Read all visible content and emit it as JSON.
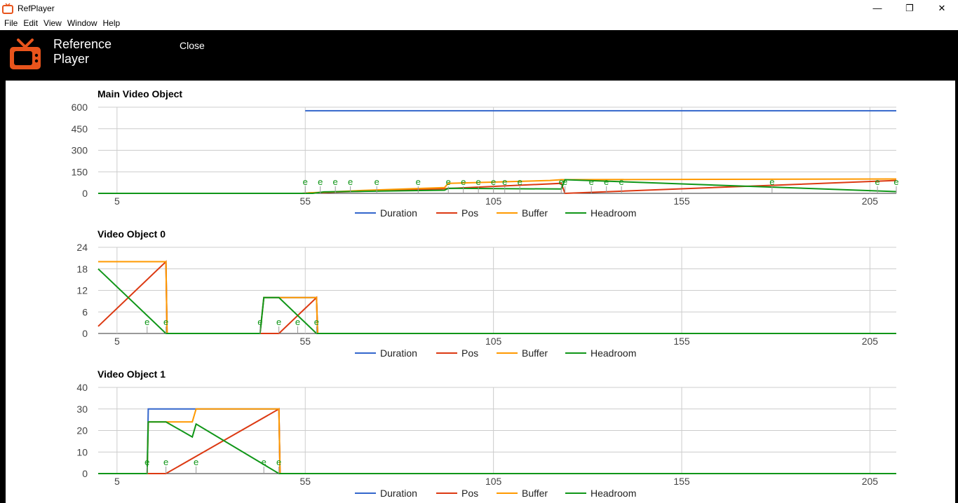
{
  "window": {
    "title": "RefPlayer",
    "controls": [
      "minimize",
      "restore",
      "close"
    ]
  },
  "menu": [
    "File",
    "Edit",
    "View",
    "Window",
    "Help"
  ],
  "header": {
    "brand_line1": "Reference",
    "brand_line2": "Player",
    "close_label": "Close"
  },
  "colors": {
    "Duration": "#3366cc",
    "Pos": "#dc3912",
    "Buffer": "#ff9900",
    "Headroom": "#109618"
  },
  "chart_data": [
    {
      "type": "line",
      "title": "Main Video Object",
      "xlim": [
        0,
        212
      ],
      "ylim": [
        0,
        600
      ],
      "xticks": [
        5,
        55,
        105,
        155,
        205
      ],
      "yticks": [
        0,
        150,
        300,
        450,
        600
      ],
      "legend_position": "bottom",
      "grid": true,
      "series": [
        {
          "name": "Duration",
          "points": [
            [
              55,
              575
            ],
            [
              212,
              575
            ]
          ]
        },
        {
          "name": "Pos",
          "points": [
            [
              0,
              0
            ],
            [
              54,
              0
            ],
            [
              56,
              3
            ],
            [
              90,
              30
            ],
            [
              123,
              70
            ],
            [
              124,
              0
            ],
            [
              212,
              90
            ]
          ]
        },
        {
          "name": "Buffer",
          "points": [
            [
              0,
              0
            ],
            [
              55,
              0
            ],
            [
              56,
              4
            ],
            [
              70,
              20
            ],
            [
              92,
              40
            ],
            [
              93,
              70
            ],
            [
              120,
              90
            ],
            [
              123,
              95
            ],
            [
              212,
              100
            ]
          ]
        },
        {
          "name": "Headroom",
          "points": [
            [
              0,
              0
            ],
            [
              57,
              0
            ],
            [
              60,
              10
            ],
            [
              92,
              22
            ],
            [
              93,
              35
            ],
            [
              123,
              30
            ],
            [
              124,
              95
            ],
            [
              212,
              12
            ]
          ]
        }
      ],
      "annotations": [
        {
          "x": 55,
          "y": 0,
          "label": "e"
        },
        {
          "x": 59,
          "y": 0,
          "label": "e"
        },
        {
          "x": 63,
          "y": 0,
          "label": "e"
        },
        {
          "x": 67,
          "y": 0,
          "label": "e"
        },
        {
          "x": 74,
          "y": 0,
          "label": "e"
        },
        {
          "x": 85,
          "y": 0,
          "label": "e"
        },
        {
          "x": 93,
          "y": 0,
          "label": "e"
        },
        {
          "x": 97,
          "y": 0,
          "label": "e"
        },
        {
          "x": 101,
          "y": 0,
          "label": "e"
        },
        {
          "x": 105,
          "y": 0,
          "label": "e"
        },
        {
          "x": 108,
          "y": 0,
          "label": "e"
        },
        {
          "x": 112,
          "y": 0,
          "label": "e"
        },
        {
          "x": 123,
          "y": 0,
          "label": "e"
        },
        {
          "x": 124,
          "y": 0,
          "label": "e"
        },
        {
          "x": 131,
          "y": 0,
          "label": "e"
        },
        {
          "x": 135,
          "y": 0,
          "label": "e"
        },
        {
          "x": 139,
          "y": 0,
          "label": "e"
        },
        {
          "x": 179,
          "y": 0,
          "label": "e"
        },
        {
          "x": 207,
          "y": 0,
          "label": "e"
        },
        {
          "x": 212,
          "y": 0,
          "label": "e"
        }
      ]
    },
    {
      "type": "line",
      "title": "Video Object 0",
      "xlim": [
        0,
        212
      ],
      "ylim": [
        0,
        24
      ],
      "xticks": [
        5,
        55,
        105,
        155,
        205
      ],
      "yticks": [
        0,
        6,
        12,
        18,
        24
      ],
      "legend_position": "bottom",
      "grid": true,
      "series": [
        {
          "name": "Duration",
          "points": [
            [
              0,
              20
            ],
            [
              18,
              20
            ],
            [
              18.3,
              0
            ],
            [
              43,
              0
            ],
            [
              44,
              10
            ],
            [
              58,
              10
            ],
            [
              58.3,
              0
            ],
            [
              212,
              0
            ]
          ]
        },
        {
          "name": "Pos",
          "points": [
            [
              0,
              2
            ],
            [
              18,
              20
            ],
            [
              18.3,
              0
            ],
            [
              48,
              0
            ],
            [
              58,
              10
            ],
            [
              58.3,
              0
            ],
            [
              212,
              0
            ]
          ]
        },
        {
          "name": "Buffer",
          "points": [
            [
              0,
              20
            ],
            [
              18,
              20
            ],
            [
              18.3,
              0
            ],
            [
              43,
              0
            ],
            [
              44,
              10
            ],
            [
              58,
              10
            ],
            [
              58.3,
              0
            ],
            [
              212,
              0
            ]
          ]
        },
        {
          "name": "Headroom",
          "points": [
            [
              0,
              18
            ],
            [
              18,
              0
            ],
            [
              43,
              0
            ],
            [
              44,
              10
            ],
            [
              48,
              10
            ],
            [
              58,
              0
            ],
            [
              212,
              0
            ]
          ]
        }
      ],
      "annotations": [
        {
          "x": 13,
          "y": 0,
          "label": "e"
        },
        {
          "x": 18,
          "y": 0,
          "label": "e"
        },
        {
          "x": 43,
          "y": 0,
          "label": "e"
        },
        {
          "x": 48,
          "y": 0,
          "label": "e"
        },
        {
          "x": 53,
          "y": 0,
          "label": "e"
        },
        {
          "x": 58,
          "y": 0,
          "label": "e"
        }
      ]
    },
    {
      "type": "line",
      "title": "Video Object 1",
      "xlim": [
        0,
        212
      ],
      "ylim": [
        0,
        40
      ],
      "xticks": [
        5,
        55,
        105,
        155,
        205
      ],
      "yticks": [
        0,
        10,
        20,
        30,
        40
      ],
      "legend_position": "bottom",
      "grid": true,
      "series": [
        {
          "name": "Duration",
          "points": [
            [
              0,
              0
            ],
            [
              13,
              0
            ],
            [
              13.3,
              30
            ],
            [
              48,
              30
            ],
            [
              48.3,
              0
            ],
            [
              212,
              0
            ]
          ]
        },
        {
          "name": "Pos",
          "points": [
            [
              0,
              0
            ],
            [
              18,
              0
            ],
            [
              48,
              30
            ],
            [
              48.3,
              0
            ],
            [
              212,
              0
            ]
          ]
        },
        {
          "name": "Buffer",
          "points": [
            [
              0,
              0
            ],
            [
              13,
              0
            ],
            [
              13.3,
              24
            ],
            [
              25,
              24
            ],
            [
              26,
              30
            ],
            [
              48,
              30
            ],
            [
              48.3,
              0
            ],
            [
              212,
              0
            ]
          ]
        },
        {
          "name": "Headroom",
          "points": [
            [
              0,
              0
            ],
            [
              13,
              0
            ],
            [
              13.3,
              24
            ],
            [
              18,
              24
            ],
            [
              25,
              17
            ],
            [
              26,
              23
            ],
            [
              48,
              0
            ],
            [
              212,
              0
            ]
          ]
        }
      ],
      "annotations": [
        {
          "x": 13,
          "y": 0,
          "label": "e"
        },
        {
          "x": 18,
          "y": 0,
          "label": "e"
        },
        {
          "x": 26,
          "y": 0,
          "label": "e"
        },
        {
          "x": 44,
          "y": 0,
          "label": "e"
        },
        {
          "x": 48,
          "y": 0,
          "label": "e"
        }
      ]
    }
  ]
}
